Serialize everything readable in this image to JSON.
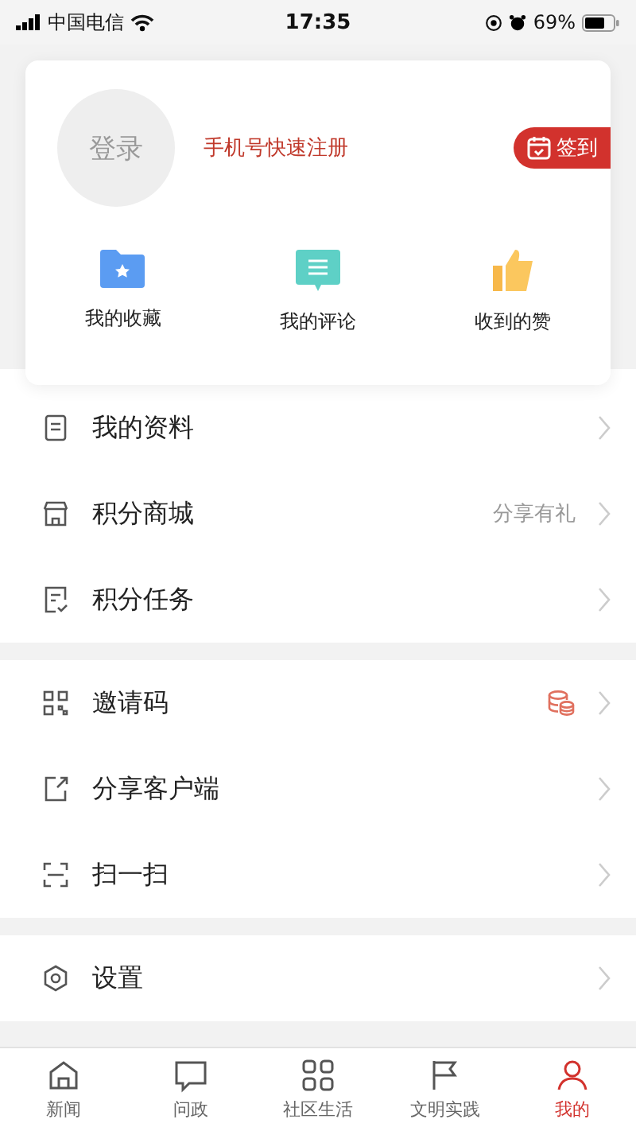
{
  "status_bar": {
    "carrier": "中国电信",
    "time": "17:35",
    "battery": "69%"
  },
  "profile": {
    "avatar_text": "登录",
    "register_link": "手机号快速注册",
    "checkin_button": "签到"
  },
  "shortcuts": [
    {
      "kind": "folder",
      "label": "我的收藏"
    },
    {
      "kind": "comment",
      "label": "我的评论"
    },
    {
      "kind": "thumb",
      "label": "收到的赞"
    }
  ],
  "menu_groups": [
    [
      {
        "kind": "profile",
        "label": "我的资料"
      },
      {
        "kind": "store",
        "label": "积分商城",
        "note": "分享有礼"
      },
      {
        "kind": "task",
        "label": "积分任务"
      }
    ],
    [
      {
        "kind": "qr",
        "label": "邀请码",
        "badge": true
      },
      {
        "kind": "share",
        "label": "分享客户端"
      },
      {
        "kind": "scan",
        "label": "扫一扫"
      }
    ],
    [
      {
        "kind": "settings",
        "label": "设置"
      }
    ]
  ],
  "tab_bar": [
    {
      "kind": "home",
      "label": "新闻",
      "selected": false
    },
    {
      "kind": "chat",
      "label": "问政",
      "selected": false
    },
    {
      "kind": "grid",
      "label": "社区生活",
      "selected": false
    },
    {
      "kind": "flag",
      "label": "文明实践",
      "selected": false
    },
    {
      "kind": "user",
      "label": "我的",
      "selected": true
    }
  ]
}
